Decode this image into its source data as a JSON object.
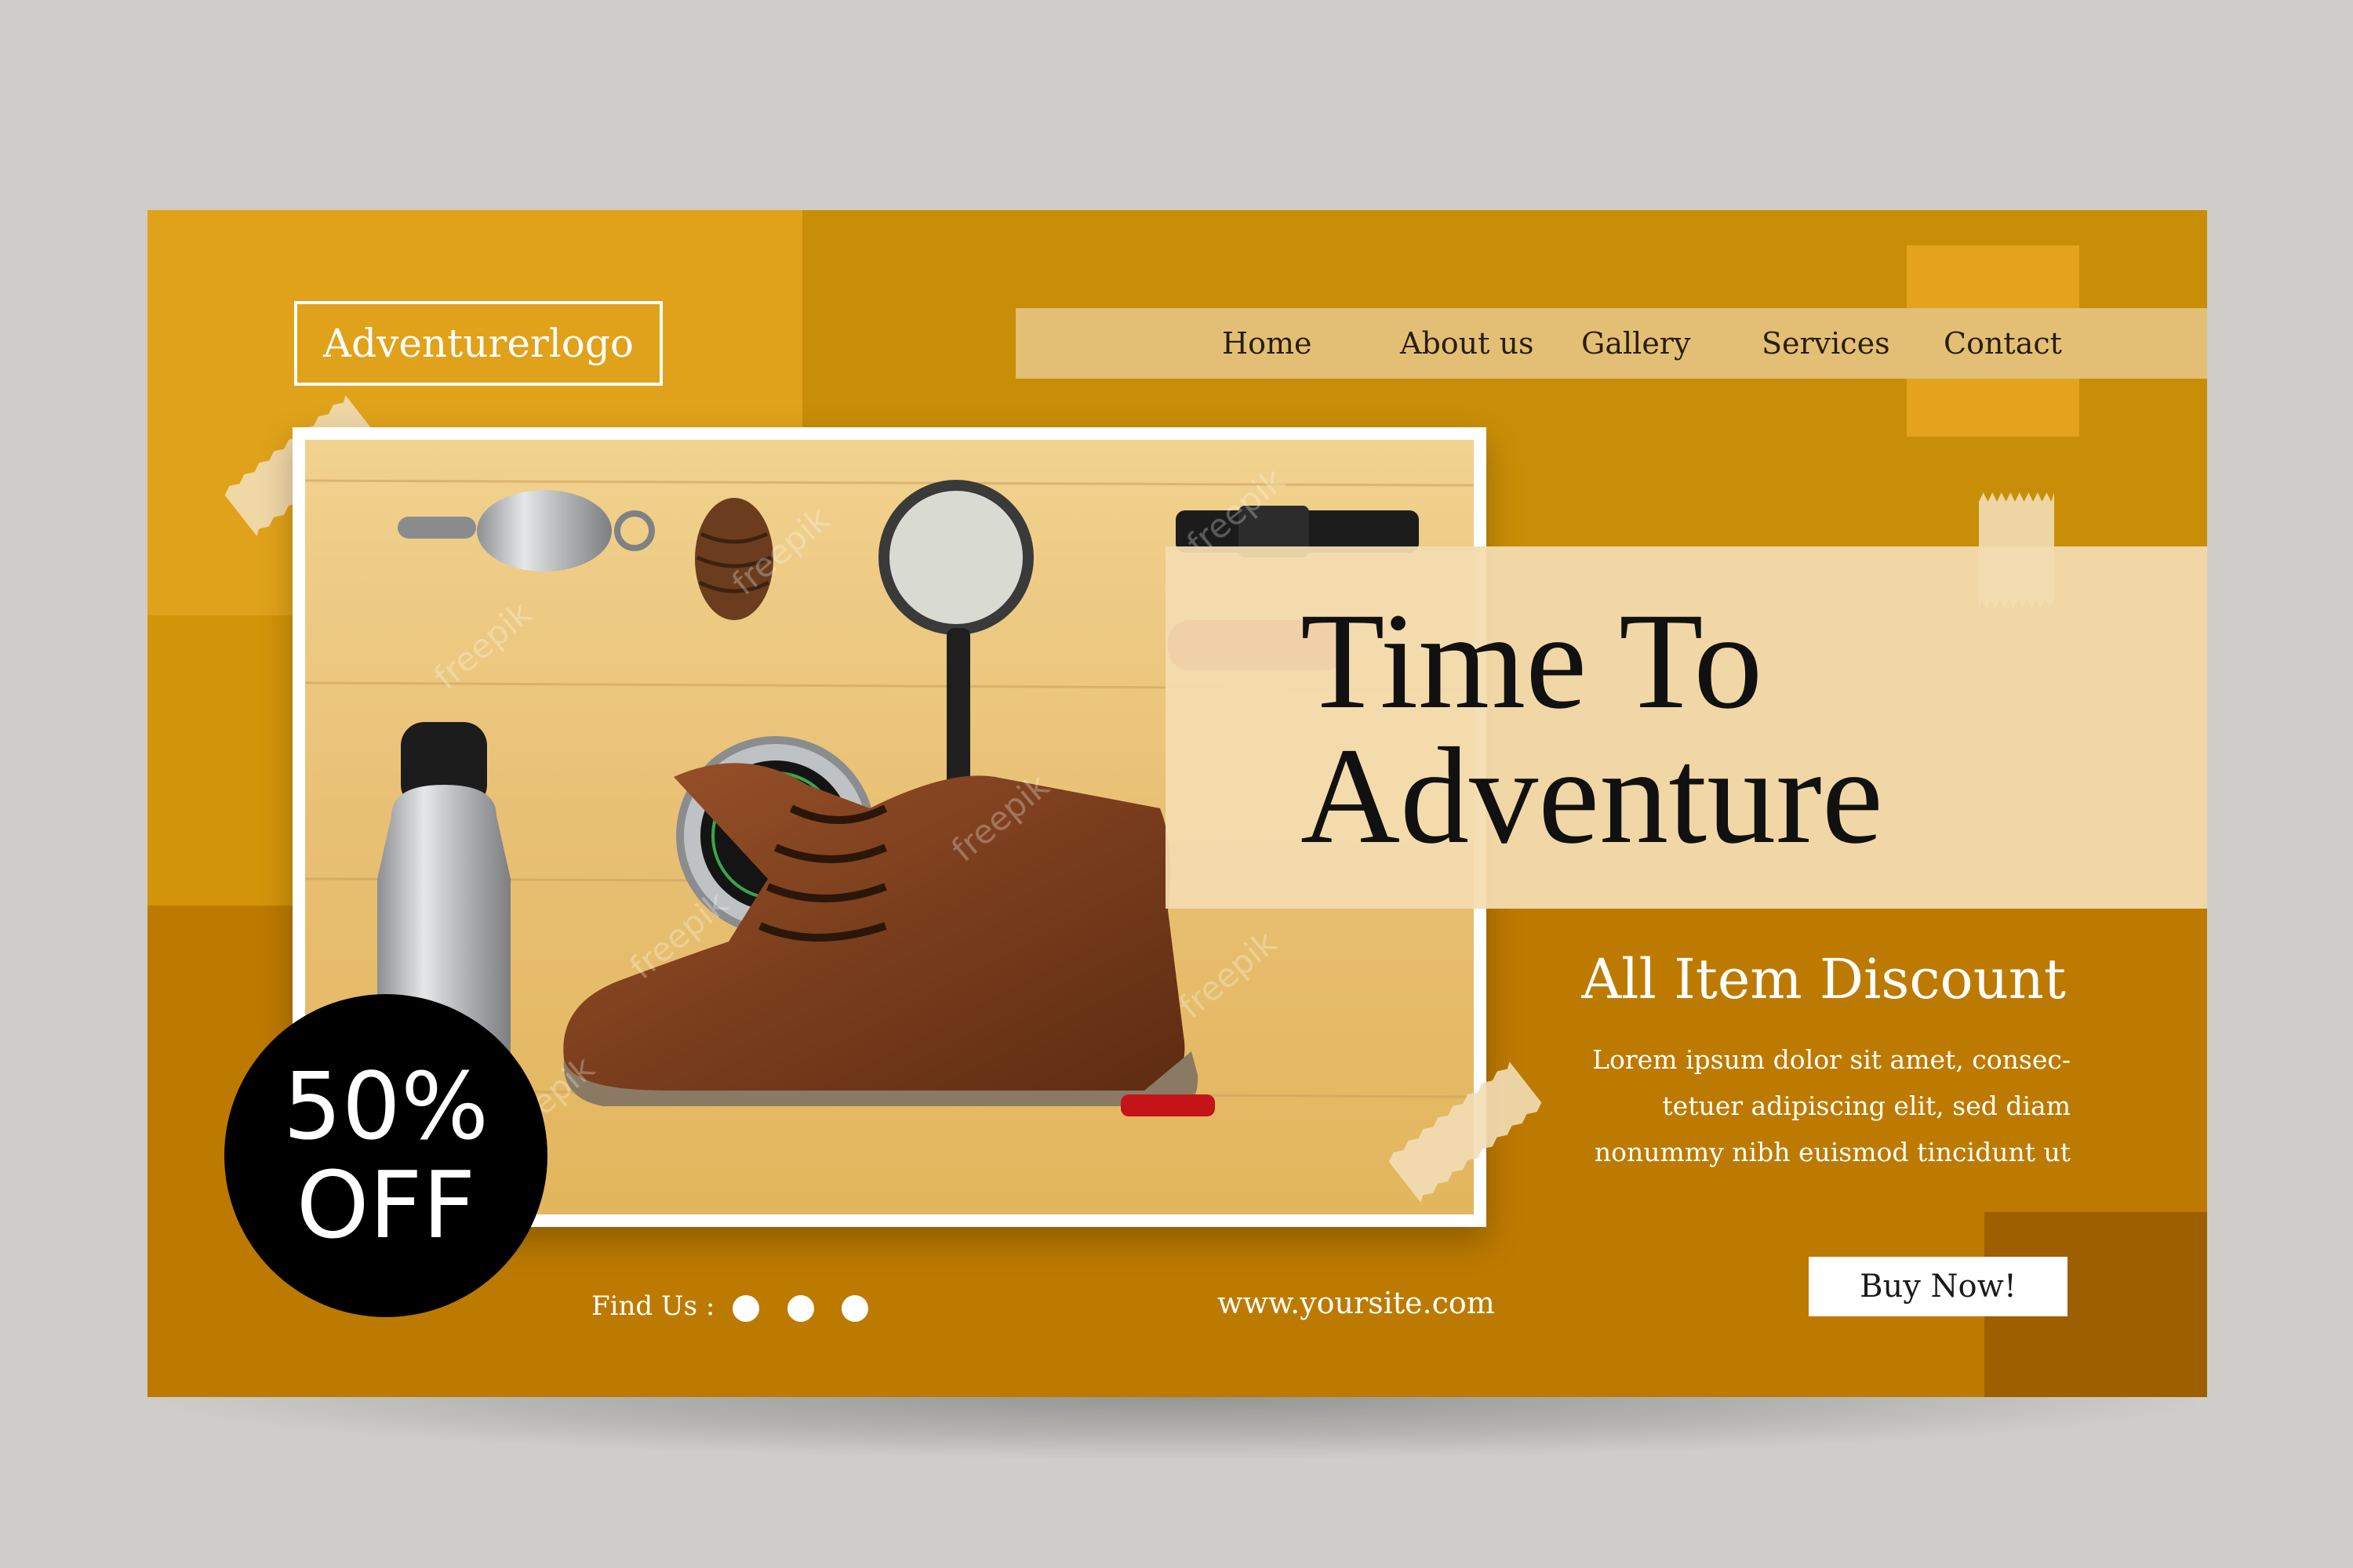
{
  "brand": {
    "logo_text": "Adventurerlogo"
  },
  "nav": {
    "items": [
      "Home",
      "About us",
      "Gallery",
      "Services",
      "Contact"
    ]
  },
  "hero": {
    "headline_line1": "Time To",
    "headline_line2": "Adventure",
    "subtitle": "All Item Discount",
    "description_lines": [
      "Lorem ipsum dolor sit amet, consec-",
      "tetuer adipiscing elit, sed diam",
      "nonummy nibh euismod tincidunt ut"
    ],
    "cta_label": "Buy Now!"
  },
  "badge": {
    "line1": "50%",
    "line2": "OFF"
  },
  "footer": {
    "find_us_label": "Find Us :",
    "website": "www.yoursite.com"
  },
  "photo": {
    "watermark": "freepik"
  },
  "colors": {
    "banner": "#c98e07",
    "banner_light": "#e0a21a",
    "banner_dark": "#bd7a00",
    "nav_bar": "#e3bf75",
    "headline_box": "#f3dcaf",
    "badge": "#000000"
  }
}
